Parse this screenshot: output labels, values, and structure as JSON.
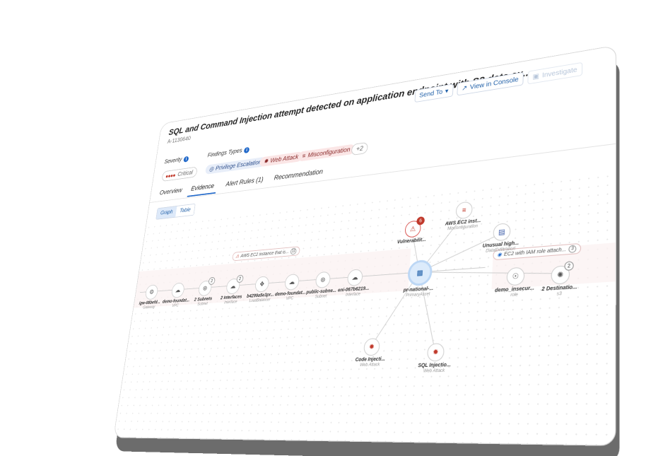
{
  "header": {
    "title": "SQL and Command Injection attempt detected on application endpoint with S3 data ex...",
    "id": "A-1130640",
    "send_to": "Send To",
    "view_console": "View in Console",
    "investigate": "Investigate"
  },
  "severity": {
    "label": "Severity",
    "value": "Critical"
  },
  "findings": {
    "label": "Findings Types",
    "chips": [
      "Privilege Escalation",
      "Web Attack",
      "Misconfiguration"
    ],
    "more": "+2"
  },
  "tabs": [
    "Overview",
    "Evidence",
    "Alert Rules (1)",
    "Recommendation"
  ],
  "view_toggle": [
    "Graph",
    "Table"
  ],
  "graph": {
    "nodes": [
      {
        "name": "igw-08befd...",
        "sub": "Gateway"
      },
      {
        "name": "demo-foundat...",
        "sub": "VPC"
      },
      {
        "name": "2 Subnets",
        "sub": "Subnet",
        "badge": "2"
      },
      {
        "name": "2 Interfaces",
        "sub": "Interface",
        "badge": "2"
      },
      {
        "name": "b4299a5e3pr...",
        "sub": "LoadBalancer"
      },
      {
        "name": "demo-foundat...",
        "sub": "VPC"
      },
      {
        "name": "public-subne...",
        "sub": "Subnet"
      },
      {
        "name": "eni-067b6219...",
        "sub": "Interface"
      },
      {
        "name": "pr-national-...",
        "sub": "PrimaryAsset"
      },
      {
        "name": "Vulnerabilit...",
        "sub": "",
        "badge": "6"
      },
      {
        "name": "AWS EC2 inst...",
        "sub": "Misconfiguration"
      },
      {
        "name": "Unusual high...",
        "sub": "DataExfiltration"
      },
      {
        "name": "demo_insecur...",
        "sub": "role"
      },
      {
        "name": "2 Destinatio...",
        "sub": "s3",
        "badge": "2"
      },
      {
        "name": "Code Injecti...",
        "sub": "Web Attack"
      },
      {
        "name": "SQL Injectio...",
        "sub": "Web Attack"
      }
    ],
    "pills": [
      {
        "text": "AWS EC2 instance that is...",
        "count": "11"
      },
      {
        "text": "EC2 with IAM role attach...",
        "count": "3"
      }
    ]
  }
}
